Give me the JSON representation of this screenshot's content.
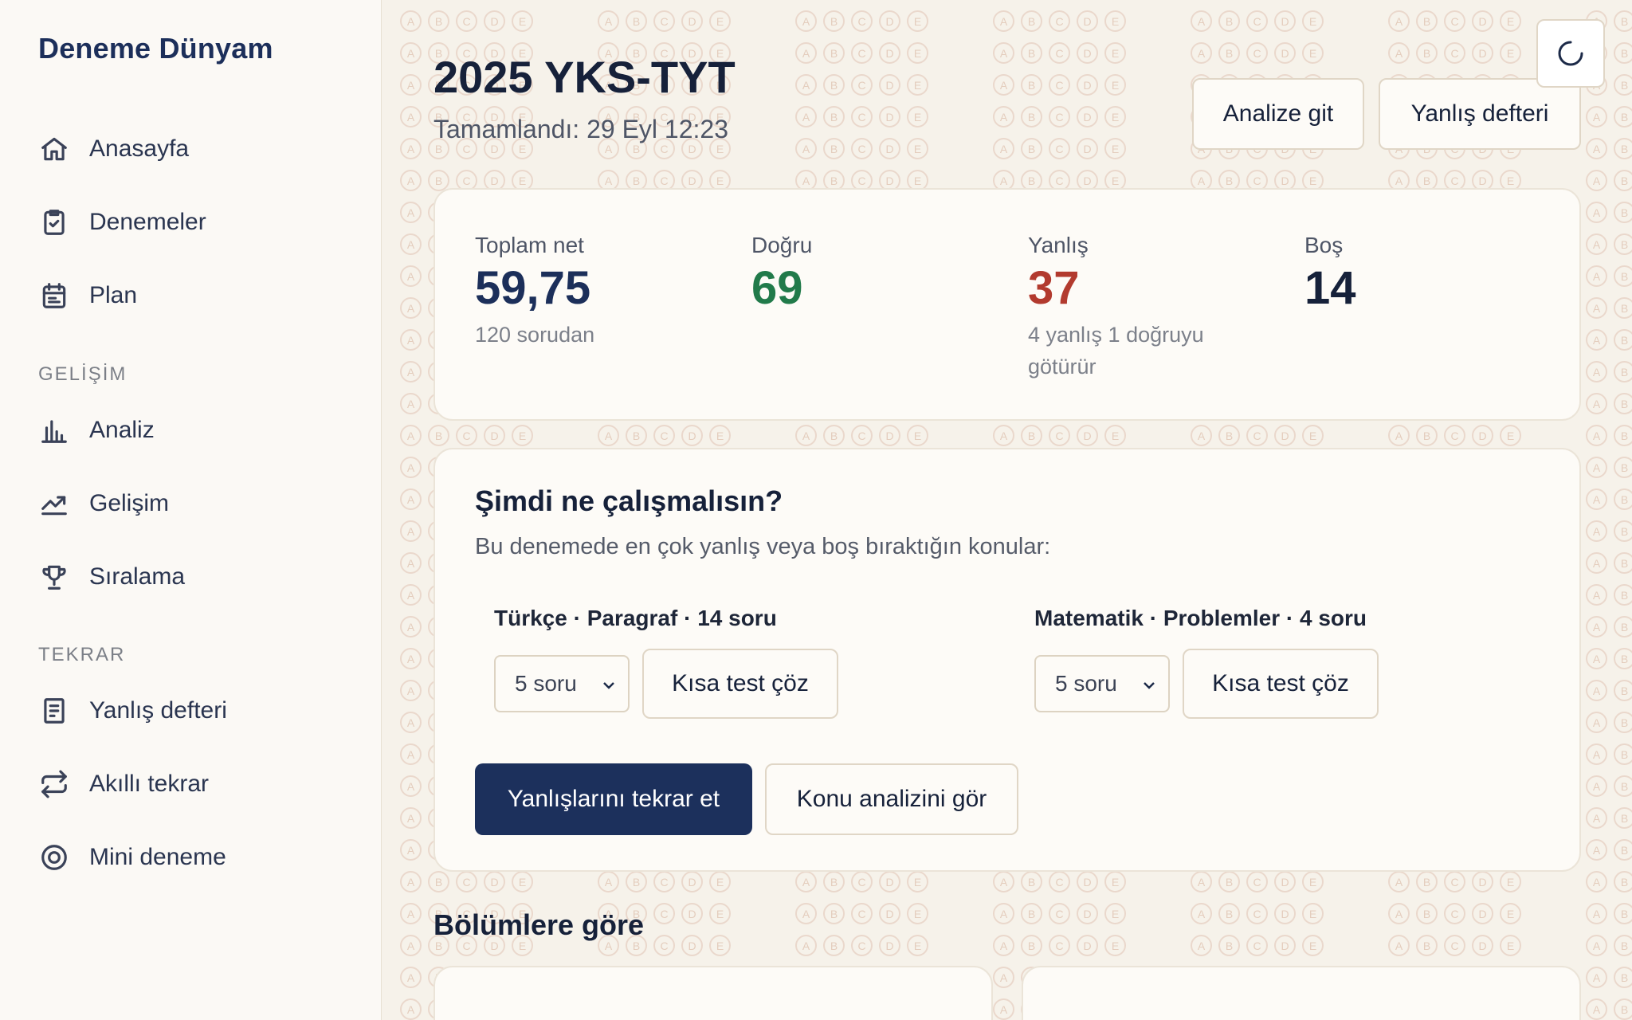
{
  "brand": "Deneme Dünyam",
  "nav": {
    "main": [
      {
        "label": "Anasayfa",
        "icon": "home-icon"
      },
      {
        "label": "Denemeler",
        "icon": "clipboard-check-icon"
      },
      {
        "label": "Plan",
        "icon": "calendar-icon"
      }
    ],
    "section_gelisim": "GELİŞİM",
    "gelisim": [
      {
        "label": "Analiz",
        "icon": "bar-chart-icon"
      },
      {
        "label": "Gelişim",
        "icon": "trending-up-icon"
      },
      {
        "label": "Sıralama",
        "icon": "trophy-icon"
      }
    ],
    "section_tekrar": "TEKRAR",
    "tekrar": [
      {
        "label": "Yanlış defteri",
        "icon": "notebook-icon"
      },
      {
        "label": "Akıllı tekrar",
        "icon": "repeat-icon"
      },
      {
        "label": "Mini deneme",
        "icon": "target-icon"
      }
    ]
  },
  "header": {
    "title": "2025 YKS-TYT",
    "subtitle": "Tamamlandı: 29 Eyl 12:23",
    "analyze_button": "Analize git",
    "notebook_button": "Yanlış defteri"
  },
  "stats": {
    "net_label": "Toplam net",
    "net_value": "59,75",
    "net_note": "120 sorudan",
    "correct_label": "Doğru",
    "correct_value": "69",
    "wrong_label": "Yanlış",
    "wrong_value": "37",
    "wrong_note_1": "4 yanlış 1 doğruyu",
    "wrong_note_2": "götürür",
    "empty_label": "Boş",
    "empty_value": "14"
  },
  "colors": {
    "correct": "#217a4a",
    "wrong": "#b23a2e",
    "navy": "#1c305c"
  },
  "study": {
    "title": "Şimdi ne çalışmalısın?",
    "description": "Bu denemede en çok yanlış veya boş bıraktığın konular:",
    "topics": [
      {
        "label": "Türkçe · Paragraf · 14 soru",
        "select_value": "5 soru",
        "button": "Kısa test çöz"
      },
      {
        "label": "Matematik · Problemler · 4 soru",
        "select_value": "5 soru",
        "button": "Kısa test çöz"
      }
    ],
    "primary_button": "Yanlışlarını tekrar et",
    "secondary_button": "Konu analizini gör"
  },
  "sections_heading": "Bölümlere göre"
}
